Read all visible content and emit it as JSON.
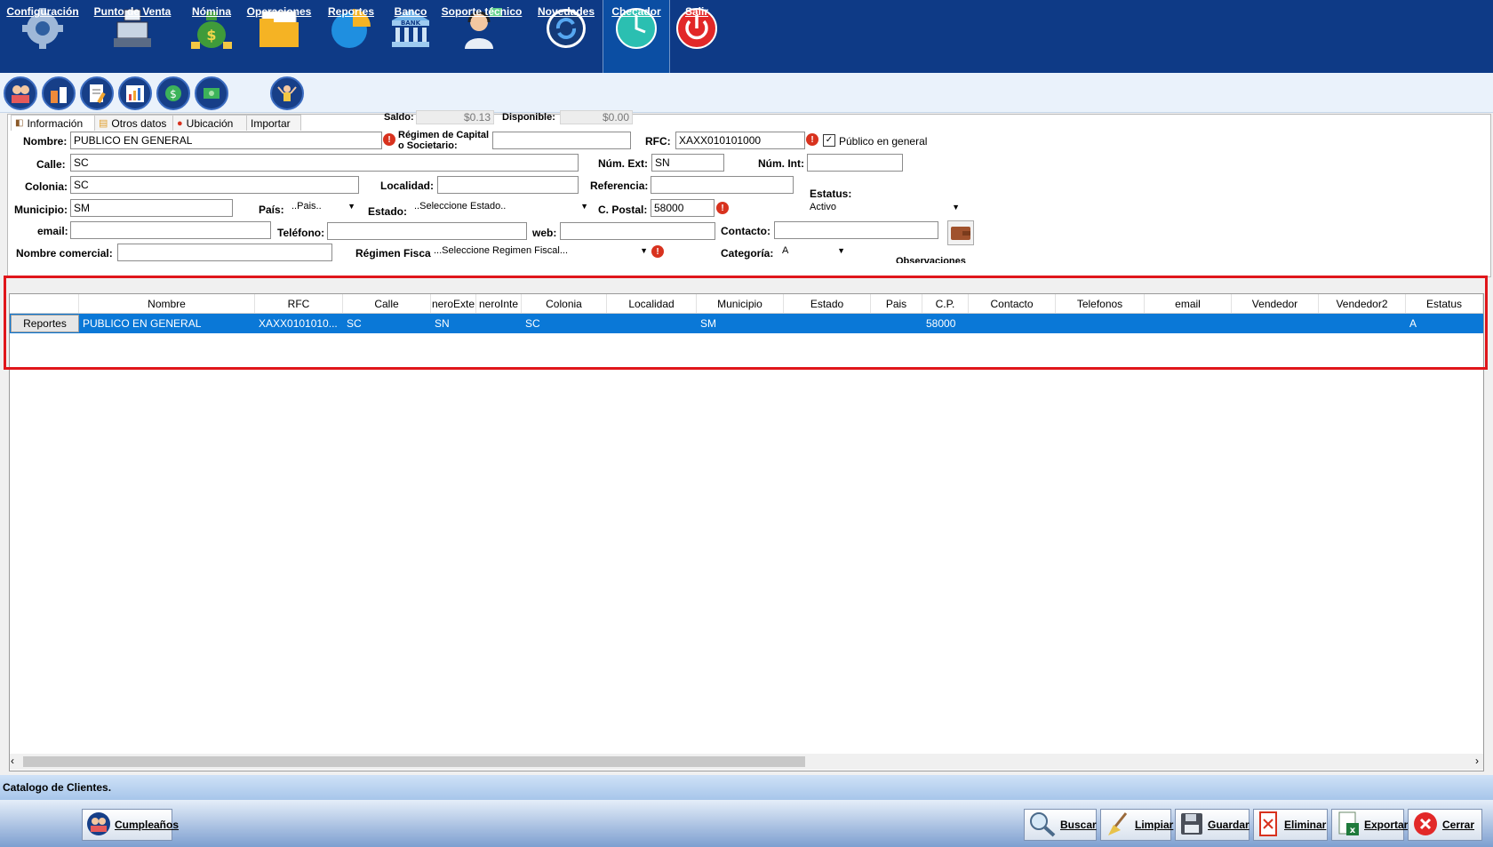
{
  "topnav": {
    "configuracion": "Configuración",
    "punto_venta": "Punto de Venta",
    "nomina": "Nómina",
    "operaciones": "Operaciones",
    "reportes": "Reportes",
    "banco": "Banco",
    "soporte": "Soporte técnico",
    "novedades": "Novedades",
    "checador": "Checador",
    "salir": "Salir",
    "bank_sign": "BANK"
  },
  "tabs": {
    "informacion": "Información",
    "otros": "Otros datos",
    "ubicacion": "Ubicación",
    "importar": "Importar"
  },
  "balances": {
    "saldo_label": "Saldo:",
    "saldo_value": "$0.13",
    "disponible_label": "Disponible:",
    "disponible_value": "$0.00"
  },
  "form": {
    "nombre_label": "Nombre:",
    "nombre_value": "PUBLICO EN GENERAL",
    "regimen_capital_label_1": "Régimen de Capital",
    "regimen_capital_label_2": "o Societario:",
    "regimen_capital_value": "",
    "rfc_label": "RFC:",
    "rfc_value": "XAXX010101000",
    "publico_general_label": "Público en general",
    "calle_label": "Calle:",
    "calle_value": "SC",
    "num_ext_label": "Núm. Ext:",
    "num_ext_value": "SN",
    "num_int_label": "Núm. Int:",
    "num_int_value": "",
    "colonia_label": "Colonia:",
    "colonia_value": "SC",
    "localidad_label": "Localidad:",
    "localidad_value": "",
    "referencia_label": "Referencia:",
    "referencia_value": "",
    "estatus_label": "Estatus:",
    "estatus_value": "Activo",
    "municipio_label": "Municipio:",
    "municipio_value": "SM",
    "pais_label": "País:",
    "pais_value": "..Pais..",
    "estado_label": "Estado:",
    "estado_value": "..Seleccione Estado..",
    "cpostal_label": "C. Postal:",
    "cpostal_value": "58000",
    "email_label": "email:",
    "email_value": "",
    "telefono_label": "Teléfono:",
    "telefono_value": "",
    "web_label": "web:",
    "web_value": "",
    "contacto_label": "Contacto:",
    "contacto_value": "",
    "nombre_comercial_label": "Nombre comercial:",
    "nombre_comercial_value": "",
    "regimen_fiscal_label": "Régimen Fiscal:",
    "regimen_fiscal_value": "...Seleccione Regimen Fiscal...",
    "categoria_label": "Categoría:",
    "categoria_value": "A",
    "observaciones_label": "Observaciones"
  },
  "grid": {
    "headers": [
      "",
      "Nombre",
      "RFC",
      "Calle",
      "neroExte",
      "neroInte",
      "Colonia",
      "Localidad",
      "Municipio",
      "Estado",
      "Pais",
      "C.P.",
      "Contacto",
      "Telefonos",
      "email",
      "Vendedor",
      "Vendedor2",
      "Estatus"
    ],
    "row": {
      "button": "Reportes",
      "cells": [
        "PUBLICO EN GENERAL",
        "XAXX0101010...",
        "SC",
        "SN",
        "",
        "SC",
        "",
        "SM",
        "",
        "",
        "58000",
        "",
        "",
        "",
        "",
        "",
        "A"
      ]
    }
  },
  "status_text": "Catalogo de Clientes.",
  "bottom": {
    "cumpleanos": "Cumpleaños",
    "buscar": "Buscar",
    "limpiar": "Limpiar",
    "guardar": "Guardar",
    "eliminar": "Eliminar",
    "exportar": "Exportar",
    "cerrar": "Cerrar"
  },
  "colors": {
    "topbar": "#0e3a86",
    "selection": "#0a78d7",
    "highlight_box": "#e0161b",
    "warning": "#d8321e"
  }
}
